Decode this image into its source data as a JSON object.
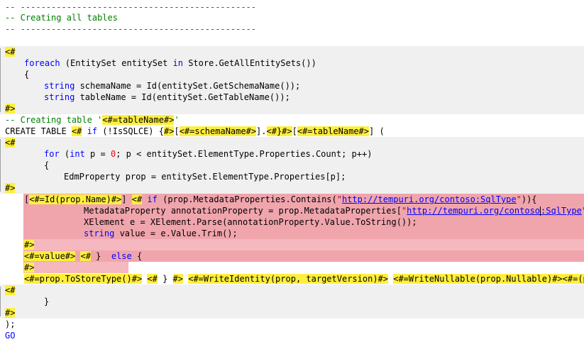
{
  "lines": [
    {
      "id": "l1",
      "text": "-- ----------------------------------------------"
    },
    {
      "id": "l2",
      "text": "-- Creating all tables"
    },
    {
      "id": "l3",
      "text": "-- ----------------------------------------------"
    },
    {
      "id": "l4a",
      "text": "<#"
    },
    {
      "id": "l5",
      "text": "foreach (EntitySet entitySet in Store.GetAllEntitySets())"
    },
    {
      "id": "l6",
      "text": "{"
    },
    {
      "id": "l7",
      "text": "string schemaName = Id(entitySet.GetSchemaName());"
    },
    {
      "id": "l8",
      "text": "string tableName = Id(entitySet.GetTableName());"
    },
    {
      "id": "l9",
      "text": "#>"
    },
    {
      "id": "l10",
      "pre": "-- Creating table '",
      "tag": "<#=tableName#>",
      "post": "'"
    },
    {
      "id": "l11",
      "text": "CREATE TABLE <# if (!IsSQLCE) {#>[<#=schemaName#>].<#}#>[<#=tableName#>] ("
    },
    {
      "id": "l12",
      "text": "<#"
    },
    {
      "id": "l13",
      "text": "for (int p = 0; p < entitySet.ElementType.Properties.Count; p++)"
    },
    {
      "id": "l14",
      "text": "{"
    },
    {
      "id": "l15",
      "text": "EdmProperty prop = entitySet.ElementType.Properties[p];"
    },
    {
      "id": "l16",
      "text": "#>"
    },
    {
      "id": "l17",
      "text": "[<#=Id(prop.Name)#>] <# if (prop.MetadataProperties.Contains(\"http://tempuri.org/contoso:SqlType\")){"
    },
    {
      "id": "l18",
      "text": "MetadataProperty annotationProperty = prop.MetadataProperties[\"http://tempuri.org/contoso:SqlType\"];"
    },
    {
      "id": "l19",
      "text": "XElement e = XElement.Parse(annotationProperty.Value.ToString());"
    },
    {
      "id": "l20",
      "text": "string value = e.Value.Trim();"
    },
    {
      "id": "l21",
      "text": "#>"
    },
    {
      "id": "l22",
      "text": "<#=value#> <# } else {"
    },
    {
      "id": "l23",
      "text": "#>"
    },
    {
      "id": "l24",
      "text": "<#=prop.ToStoreType()#> <# } #> <#=WriteIdentity(prop, targetVersion)#> <#=WriteNullable(prop.Nullable)#><#=(p <"
    },
    {
      "id": "l25",
      "text": "<#"
    },
    {
      "id": "l26",
      "text": "}"
    },
    {
      "id": "l27",
      "text": "#>"
    },
    {
      "id": "l28",
      "text": ");"
    },
    {
      "id": "l29",
      "text": "GO"
    }
  ],
  "tokens": {
    "dashes": "-- ----------------------------------------------",
    "comment_title": "-- Creating all tables",
    "open": "<#",
    "close": "#>",
    "foreach_kw": "foreach",
    "foreach_rest1": " (EntitySet entitySet ",
    "in_kw": "in",
    "foreach_rest2": " Store.GetAllEntitySets())",
    "brace_open": "{",
    "brace_close": "}",
    "string_kw": "string",
    "schema_rest": " schemaName = Id(entitySet.GetSchemaName());",
    "table_rest": " tableName = Id(entitySet.GetTableName());",
    "creating_table_pre": "-- Creating table '",
    "tablename_tag": "<#=tableName#>",
    "quote": "'",
    "create_table": "CREATE TABLE ",
    "if_open": "<#",
    "if_kw": " if",
    "if_cond": " (!IsSQLCE) {",
    "bracket_open": "[",
    "schemaname_tag": "<#=schemaName#>",
    "bracket_dot": "].",
    "close_brace_tag": "<#}#>",
    "bracket_paren": "] (",
    "for_kw": "for",
    "for_p1": " (",
    "int_kw": "int",
    "for_p2": " p = ",
    "zero": "0",
    "for_p3": "; p < entitySet.ElementType.Properties.Count; p++)",
    "edm_line": "EdmProperty prop = entitySet.ElementType.Properties[p];",
    "id_prop_tag": "<#=Id(prop.Name)#>",
    "bracket_close_sp": "] ",
    "if_meta": " (prop.MetadataProperties.Contains(",
    "dq": "\"",
    "url": "http://tempuri.org/contoso:SqlType",
    "paren_brace": ")){",
    "meta_line_pre": "MetadataProperty annotationProperty = prop.MetadataProperties[",
    "url_a": "http://tempuri.org/contoso",
    "url_b": ":SqlType",
    "meta_line_post": "];",
    "xelement_line": "XElement e = XElement.Parse(annotationProperty.Value.ToString());",
    "value_rest": " value = e.Value.Trim();",
    "value_tag": "<#=value#>",
    "else_kw": " else",
    "else_close": " } ",
    "else_end": " {",
    "storetype_tag": "<#=prop.ToStoreType()#>",
    "endif_tag_a": "<#",
    "endif_mid": " } ",
    "write_identity": "<#=WriteIdentity(prop, targetVersion)#>",
    "write_nullable": "<#=WriteNullable(prop.Nullable)#>",
    "cond_tag": "<#=(p <",
    "paren_semi": ");",
    "go": "GO",
    "space": " "
  },
  "colors": {
    "keyword": "#0000ff",
    "comment": "#008000",
    "string": "#a31515",
    "number": "#ff0000",
    "tag_highlight": "#ffef3d",
    "template_region": "#f0f0f0",
    "selection": "#f0a5ad"
  }
}
